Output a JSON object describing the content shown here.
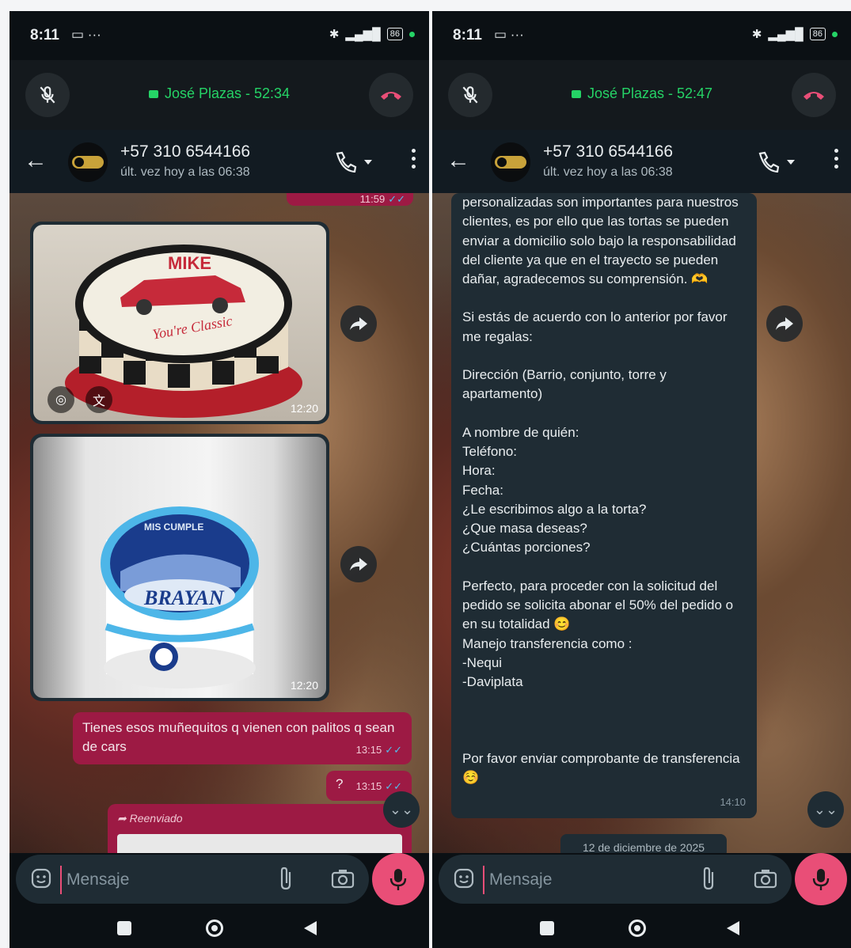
{
  "left": {
    "status": {
      "time": "8:11"
    },
    "call": {
      "caller": "José Plazas",
      "duration": "52:34"
    },
    "header": {
      "contact": "+57 310 6544166",
      "last_seen": "últ. vez hoy a las 06:38"
    },
    "top_bubble_time": "11:59",
    "image1": {
      "text1": "MIKE",
      "text2": "You're Classic",
      "time": "12:20"
    },
    "image2": {
      "text1": "MIS CUMPLE",
      "text2": "BRAYAN",
      "time": "12:20"
    },
    "msg1": {
      "text": "Tienes esos muñequitos q  vienen con palitos q sean de cars",
      "time": "13:15"
    },
    "msg2": {
      "text": "?",
      "time": "13:15"
    },
    "forwarded_label": "Reenviado",
    "input": {
      "placeholder": "Mensaje"
    }
  },
  "right": {
    "status": {
      "time": "8:11"
    },
    "call": {
      "caller": "José Plazas",
      "duration": "52:47"
    },
    "header": {
      "contact": "+57 310 6544166",
      "last_seen": "últ. vez hoy a las 06:38"
    },
    "incoming": {
      "para1": "personalizadas son importantes para nuestros clientes, es por ello que las tortas se pueden enviar a domicilio solo bajo la responsabilidad del cliente ya que en el trayecto se pueden dañar, agradecemos su comprensión. 🫶",
      "para2": "Si estás de acuerdo con lo anterior por favor me regalas:",
      "para3": "Dirección (Barrio, conjunto, torre y apartamento)",
      "para4": "A nombre de quién:\nTeléfono:\nHora:\nFecha:\n¿Le escribimos algo a la torta?\n¿Que masa deseas?\n¿Cuántas porciones?",
      "para5": "Perfecto, para proceder con la solicitud del pedido se solicita abonar el 50% del pedido o en su totalidad 😊\nManejo transferencia como :\n-Nequi\n-Daviplata",
      "para6": "Por favor enviar comprobante de transferencia ☺️",
      "time": "14:10"
    },
    "date_chip": "12 de diciembre de 2025",
    "input": {
      "placeholder": "Mensaje"
    }
  },
  "colors": {
    "accent_pink": "#e94e77",
    "outgoing_bubble": "#9d1a44",
    "call_green": "#25d366",
    "read_ticks": "#53bdeb"
  },
  "icons": [
    "mic-off-icon",
    "hang-up-icon",
    "back-arrow-icon",
    "phone-icon",
    "menu-icon",
    "forward-icon",
    "chevron-double-down-icon",
    "emoji-icon",
    "attach-icon",
    "camera-icon",
    "mic-icon",
    "nav-square-icon",
    "nav-circle-icon",
    "nav-back-icon"
  ]
}
